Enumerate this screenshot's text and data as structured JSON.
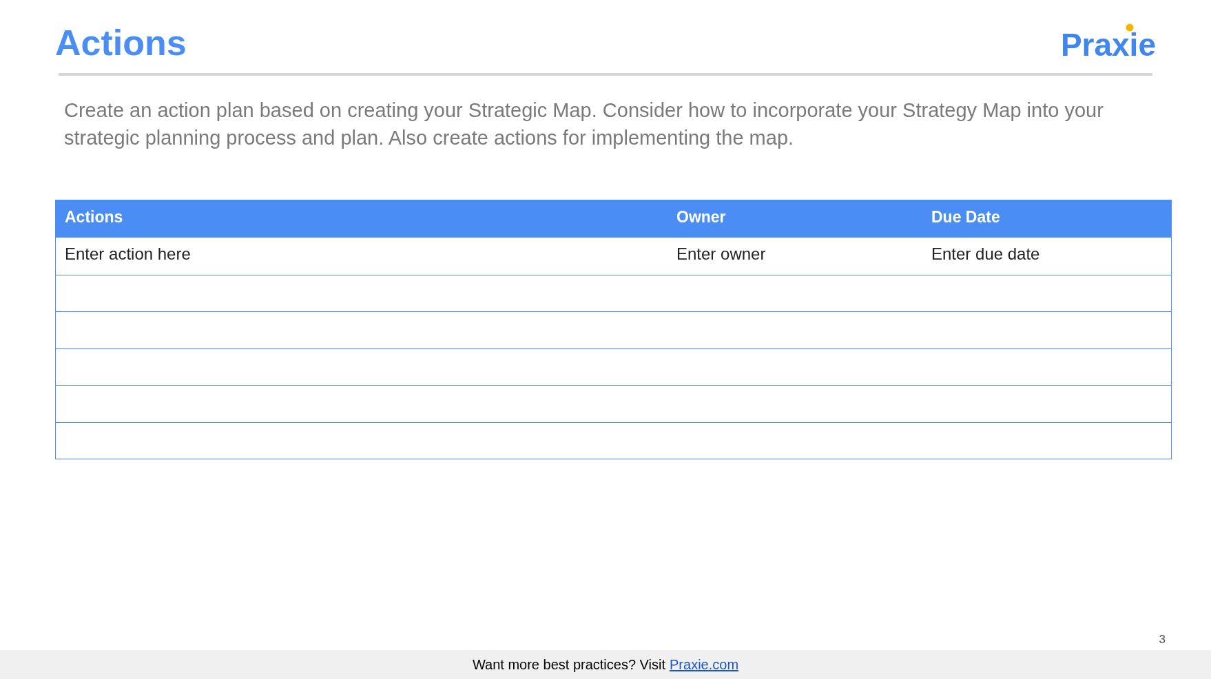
{
  "slide": {
    "title": "Actions",
    "logo": "Praxie",
    "intro": "Create an action plan based on creating your Strategic Map. Consider how to incorporate your Strategy Map into your strategic planning process and plan. Also create actions for implementing the map.",
    "page_number": "3"
  },
  "table": {
    "columns": [
      "Actions",
      "Owner",
      "Due Date"
    ],
    "rows": [
      {
        "kind": "filled",
        "cells": [
          "Enter action here",
          "Enter owner",
          "Enter due date"
        ]
      },
      {
        "kind": "blank"
      },
      {
        "kind": "blank"
      },
      {
        "kind": "blank"
      },
      {
        "kind": "blank"
      },
      {
        "kind": "blank"
      }
    ]
  },
  "footer": {
    "text": "Want more best practices? Visit",
    "link": "Praxie.com"
  }
}
